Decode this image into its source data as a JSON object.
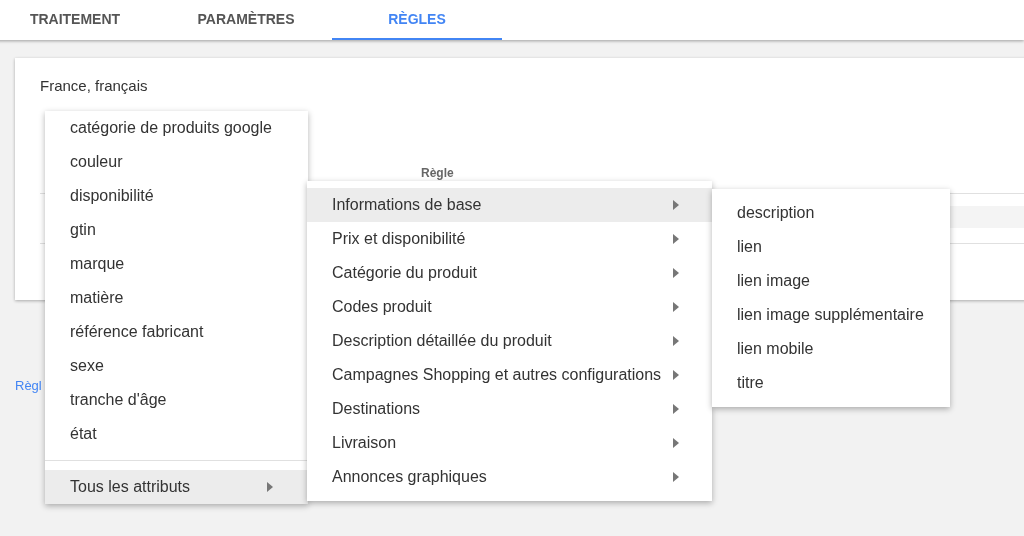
{
  "tabs": [
    {
      "label": "TRAITEMENT",
      "selected": false
    },
    {
      "label": "PARAMÈTRES",
      "selected": false
    },
    {
      "label": "RÈGLES",
      "selected": true
    }
  ],
  "card": {
    "title": "France, français",
    "column_header": "Règle"
  },
  "link": "Règl",
  "menus": [
    {
      "items": [
        {
          "label": "catégorie de produits google",
          "kind": "item",
          "highlighted": false
        },
        {
          "label": "couleur",
          "kind": "item",
          "highlighted": false
        },
        {
          "label": "disponibilité",
          "kind": "item",
          "highlighted": false
        },
        {
          "label": "gtin",
          "kind": "item",
          "highlighted": false
        },
        {
          "label": "marque",
          "kind": "item",
          "highlighted": false
        },
        {
          "label": "matière",
          "kind": "item",
          "highlighted": false
        },
        {
          "label": "référence fabricant",
          "kind": "item",
          "highlighted": false
        },
        {
          "label": "sexe",
          "kind": "item",
          "highlighted": false
        },
        {
          "label": "tranche d'âge",
          "kind": "item",
          "highlighted": false
        },
        {
          "label": "état",
          "kind": "item",
          "highlighted": false
        },
        {
          "label": "Tous les attributs",
          "kind": "submenu",
          "highlighted": true
        }
      ]
    },
    {
      "items": [
        {
          "label": "Informations de base",
          "kind": "submenu",
          "highlighted": true
        },
        {
          "label": "Prix et disponibilité",
          "kind": "submenu",
          "highlighted": false
        },
        {
          "label": "Catégorie du produit",
          "kind": "submenu",
          "highlighted": false
        },
        {
          "label": "Codes produit",
          "kind": "submenu",
          "highlighted": false
        },
        {
          "label": "Description détaillée du produit",
          "kind": "submenu",
          "highlighted": false
        },
        {
          "label": "Campagnes Shopping et autres configurations",
          "kind": "submenu",
          "highlighted": false
        },
        {
          "label": "Destinations",
          "kind": "submenu",
          "highlighted": false
        },
        {
          "label": "Livraison",
          "kind": "submenu",
          "highlighted": false
        },
        {
          "label": "Annonces graphiques",
          "kind": "submenu",
          "highlighted": false
        }
      ]
    },
    {
      "items": [
        {
          "label": "description",
          "kind": "item",
          "highlighted": false
        },
        {
          "label": "lien",
          "kind": "item",
          "highlighted": false
        },
        {
          "label": "lien image",
          "kind": "item",
          "highlighted": false
        },
        {
          "label": "lien image supplémentaire",
          "kind": "item",
          "highlighted": false
        },
        {
          "label": "lien mobile",
          "kind": "item",
          "highlighted": false
        },
        {
          "label": "titre",
          "kind": "item",
          "highlighted": false
        }
      ]
    }
  ]
}
